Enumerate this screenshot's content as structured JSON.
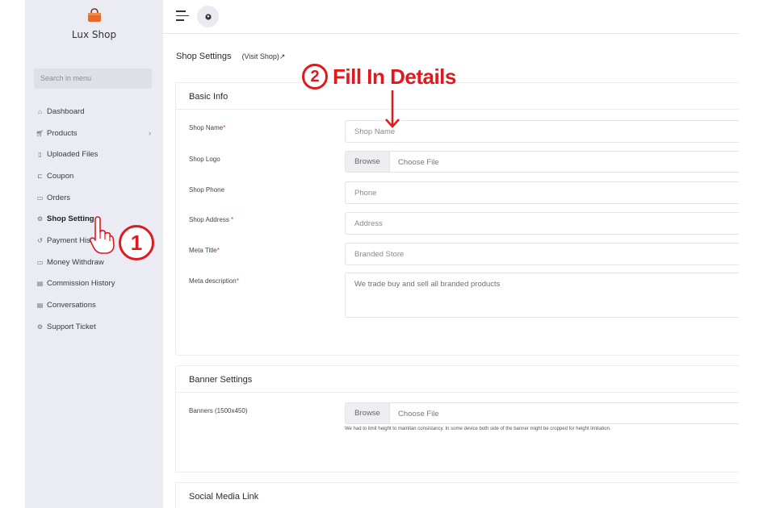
{
  "brand": {
    "name": "Lux Shop"
  },
  "sidebar": {
    "search_placeholder": "Search in menu",
    "items": [
      {
        "label": "Dashboard",
        "icon": "home-icon"
      },
      {
        "label": "Products",
        "icon": "cart-icon",
        "has_children": true
      },
      {
        "label": "Uploaded Files",
        "icon": "file-icon"
      },
      {
        "label": "Coupon",
        "icon": "coupon-icon"
      },
      {
        "label": "Orders",
        "icon": "orders-icon"
      },
      {
        "label": "Shop Setting",
        "icon": "gear-icon",
        "active": true
      },
      {
        "label": "Payment His",
        "icon": "history-icon"
      },
      {
        "label": "Money Withdraw",
        "icon": "withdraw-icon"
      },
      {
        "label": "Commission History",
        "icon": "document-icon"
      },
      {
        "label": "Conversations",
        "icon": "chat-icon"
      },
      {
        "label": "Support Ticket",
        "icon": "support-icon"
      }
    ]
  },
  "main": {
    "title": "Shop Settings",
    "visit_link": "(Visit Shop)",
    "basic_info": {
      "title": "Basic Info",
      "shop_name_label": "Shop Name",
      "shop_name_placeholder": "Shop Name",
      "shop_logo_label": "Shop Logo",
      "browse_label": "Browse",
      "choose_file_label": "Choose File",
      "shop_phone_label": "Shop Phone",
      "shop_phone_placeholder": "Phone",
      "shop_address_label": "Shop Address",
      "shop_address_placeholder": "Address",
      "meta_title_label": "Meta Title",
      "meta_title_value": "Branded Store",
      "meta_description_label": "Meta description",
      "meta_description_value": "We trade buy and sell all branded products",
      "required_mark": "*"
    },
    "banner_settings": {
      "title": "Banner Settings",
      "banners_label": "Banners (1500x450)",
      "browse_label": "Browse",
      "choose_file_label": "Choose File",
      "hint": "We had to limit height to maintian consistancy. In some device both side of the banner might be cropped for height limitation."
    },
    "social_media": {
      "title": "Social Media Link"
    }
  },
  "annotations": {
    "step1_number": "1",
    "step2_number": "2",
    "step2_text": "Fill In Details"
  },
  "colors": {
    "sidebar_bg": "#ebebf3",
    "annotation_red": "#e0191f",
    "logo_orange": "#e8692a"
  }
}
